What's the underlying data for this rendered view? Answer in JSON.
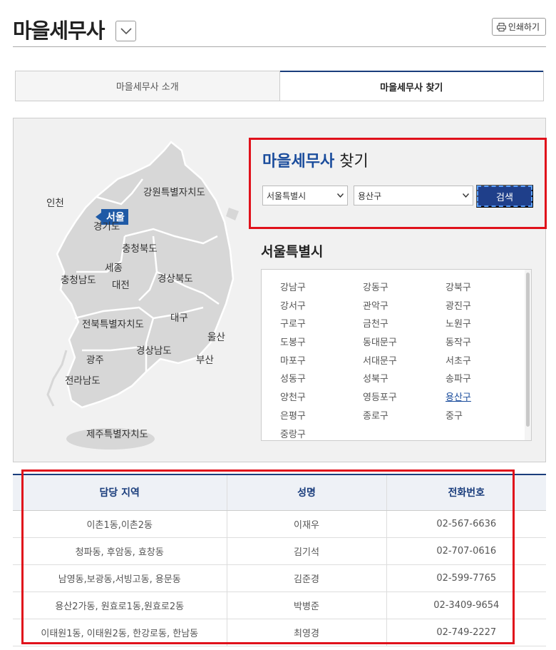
{
  "header": {
    "title": "마을세무사",
    "print_label": "인쇄하기"
  },
  "tabs": [
    {
      "label": "마을세무사 소개",
      "active": false
    },
    {
      "label": "마을세무사 찾기",
      "active": true
    }
  ],
  "map": {
    "regions": [
      "인천",
      "서울",
      "강원특별자치도",
      "경기도",
      "충청북도",
      "세종",
      "충청남도",
      "대전",
      "경상북도",
      "대구",
      "전북특별자치도",
      "울산",
      "광주",
      "경상남도",
      "부산",
      "전라남도",
      "제주특별자치도"
    ]
  },
  "search": {
    "title_highlight": "마을세무사",
    "title_rest": "찾기",
    "city_selected": "서울특별시",
    "district_selected": "용산구",
    "button_label": "검색"
  },
  "district_panel": {
    "heading": "서울특별시",
    "districts": [
      "강남구",
      "강동구",
      "강북구",
      "강서구",
      "관악구",
      "광진구",
      "구로구",
      "금천구",
      "노원구",
      "도봉구",
      "동대문구",
      "동작구",
      "마포구",
      "서대문구",
      "서초구",
      "성동구",
      "성북구",
      "송파구",
      "양천구",
      "영등포구",
      "용산구",
      "은평구",
      "종로구",
      "중구",
      "중랑구"
    ],
    "active_district": "용산구"
  },
  "table": {
    "headers": [
      "담당 지역",
      "성명",
      "전화번호"
    ],
    "rows": [
      [
        "이촌1동,이촌2동",
        "이재우",
        "02-567-6636"
      ],
      [
        "청파동, 후암동, 효창동",
        "김기석",
        "02-707-0616"
      ],
      [
        "남영동,보광동,서빙고동, 용문동",
        "김준경",
        "02-599-7765"
      ],
      [
        "용산2가동, 원효로1동,원효로2동",
        "박병준",
        "02-3409-9654"
      ],
      [
        "이태원1동, 이태원2동, 한강로동, 한남동",
        "최영경",
        "02-749-2227"
      ]
    ]
  },
  "colors": {
    "accent": "#1a4c9c",
    "highlight_box": "#e0111b",
    "button": "#1f3f8a"
  }
}
